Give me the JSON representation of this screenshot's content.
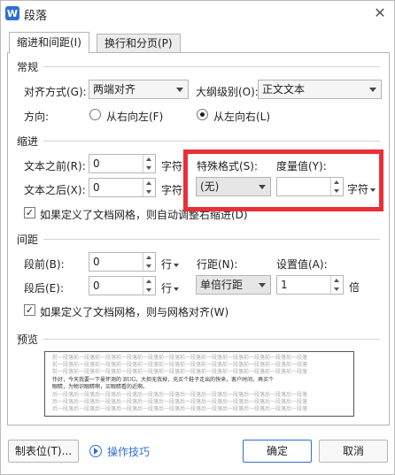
{
  "window": {
    "title": "段落",
    "logo_letter": "W"
  },
  "tabs": [
    {
      "label": "缩进和间距(I)",
      "active": true
    },
    {
      "label": "换行和分页(P)",
      "active": false
    }
  ],
  "general": {
    "section": "常规",
    "alignment_label": "对齐方式(G):",
    "alignment_value": "两端对齐",
    "outline_label": "大纲级别(O):",
    "outline_value": "正文文本",
    "direction_label": "方向:",
    "rtl_label": "从右向左(F)",
    "ltr_label": "从左向右(L)",
    "selected_direction": "ltr"
  },
  "indent": {
    "section": "缩进",
    "before_label": "文本之前(R):",
    "before_value": "0",
    "before_unit": "字符",
    "after_label": "文本之后(X):",
    "after_value": "0",
    "after_unit": "字符",
    "special_label": "特殊格式(S):",
    "special_value": "(无)",
    "measure_label": "度量值(Y):",
    "measure_value": "",
    "measure_unit": "字符",
    "grid_check_label": "如果定义了文档网格，则自动调整右缩进(D)",
    "grid_checked": true
  },
  "spacing": {
    "section": "间距",
    "before_label": "段前(B):",
    "before_value": "0",
    "before_unit": "行",
    "after_label": "段后(E):",
    "after_value": "0",
    "after_unit": "行",
    "line_label": "行距(N):",
    "line_value": "单倍行距",
    "setting_label": "设置值(A):",
    "setting_value": "1",
    "setting_unit": "倍",
    "grid_check_label": "如果定义了文档网格，则与网格对齐(W)",
    "grid_checked": true
  },
  "preview": {
    "section": "预览",
    "lines": [
      "前一段落前一段落前一段落前一段落前一段落前一段落前一段落前一段落前一段落前一段落前一段落前一段落",
      "前一段落前一段落前一段落前一段落前一段落前一段落前一段落前一段落前一段落前一段落前一段落前一段落",
      "前一段落前一段落前一段落前一段落前一段落前一段落前一段落前一段落前一段落前一段落前一段落前一段落",
      "作好，今天我要一下曼怀测的 BUG，大担无我掉，充买个鞋子走出的快来，客户时间，再买个",
      "眼睛，为物识眼睛啊，买眼睛看的近啊。",
      "后一段落后一段落后一段落后一段落后一段落后一段落后一段落后一段落后一段落后一段落后一段落后一段落",
      "后一段落后一段落后一段落后一段落后一段落后一段落后一段落后一段落后一段落后一段落后一段落后一段落",
      "后一段落后一段落后一段落后一段落后一段落后一段落后一段落后一段落后一段落后一段落后一段落后一段落"
    ]
  },
  "footer": {
    "tabs_button": "制表位(T)...",
    "help_link": "操作技巧",
    "ok_button": "确定",
    "cancel_button": "取消"
  },
  "colors": {
    "accent": "#2f6fd4",
    "highlight_box": "#ea2f37"
  },
  "icons": {
    "logo": "wps-writer-icon",
    "close": "close-icon",
    "help": "play-circle-icon"
  }
}
